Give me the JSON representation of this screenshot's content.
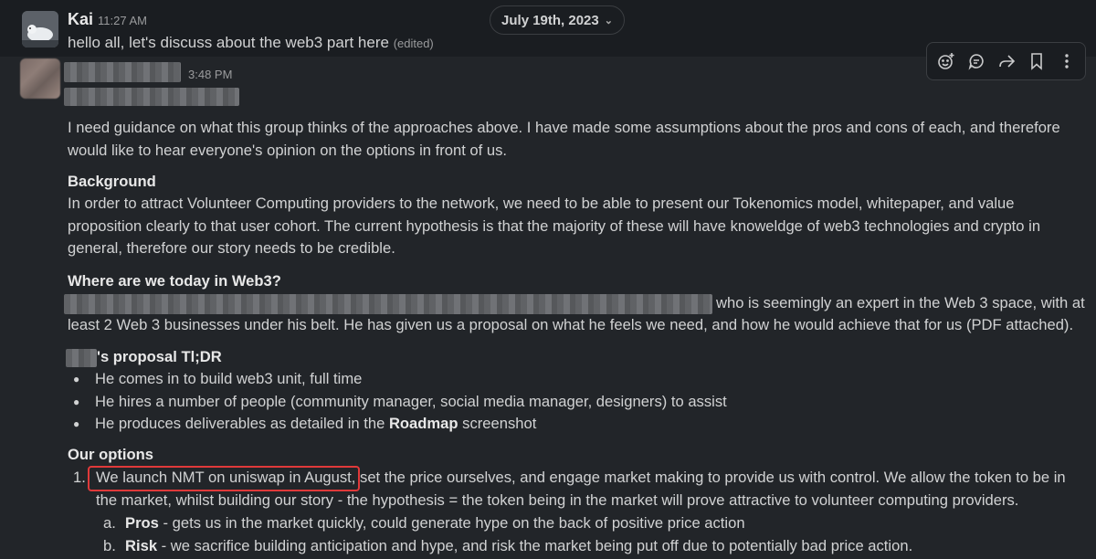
{
  "message1": {
    "author": "Kai",
    "time": "11:27 AM",
    "text": "hello all, let's discuss about the web3 part here",
    "edited": "(edited)"
  },
  "date_divider": {
    "label": "July 19th, 2023"
  },
  "hover_toolbar": {
    "icons": [
      "add-reaction-icon",
      "reply-in-thread-icon",
      "forward-icon",
      "bookmark-icon",
      "more-actions-icon"
    ]
  },
  "message2": {
    "time": "3:48 PM",
    "intro": "I need guidance on what this group thinks of the approaches above. I have made some assumptions about the pros and cons of each, and therefore would like to hear everyone's opinion on the options in front of us.",
    "background_heading": "Background",
    "background_text": "In order to attract Volunteer Computing providers to the network, we need to be able to present our Tokenomics model, whitepaper, and value proposition clearly to that user cohort. The current hypothesis is that the majority of these will have knoweldge of web3 technologies and crypto in general, therefore our story needs to be credible.",
    "web3_heading": "Where are we today in Web3?",
    "web3_line1_tail": "who is seemingly an expert in the Web 3 space, with at",
    "web3_line2": "least 2 Web 3 businesses under his belt. He has given us a proposal on what he feels we need, and how he would achieve that for us (PDF attached).",
    "proposal_heading": "'s proposal Tl;DR",
    "proposal_bullets": [
      "He comes in to build web3 unit, full time",
      "He hires a number of people (community manager, social media manager, designers) to assist"
    ],
    "bullet3_prefix": "He produces deliverables as detailed in the ",
    "bullet3_bold": "Roadmap",
    "bullet3_suffix": " screenshot",
    "options_heading": "Our options",
    "option1_num": "1.",
    "option1_highlight": "We launch NMT on uniswap in August,",
    "option1_rest": " set the price ourselves, and engage market making to provide us with control. We allow the token to be in",
    "option1_line2": "the market, whilst building our story - the hypothesis = the token being in the market will prove attractive to volunteer computing providers.",
    "sub_a_label": "a.",
    "sub_a_bold": "Pros",
    "sub_a_text": " - gets us in the market quickly, could generate hype on the back of positive price action",
    "sub_b_label": "b.",
    "sub_b_bold": "Risk",
    "sub_b_text": " - we sacrifice building anticipation and hype, and risk the market being put off due to potentially bad price action."
  },
  "colors": {
    "background": "#1a1d21",
    "hover_background": "#222529",
    "highlight_border": "#e0393a"
  }
}
